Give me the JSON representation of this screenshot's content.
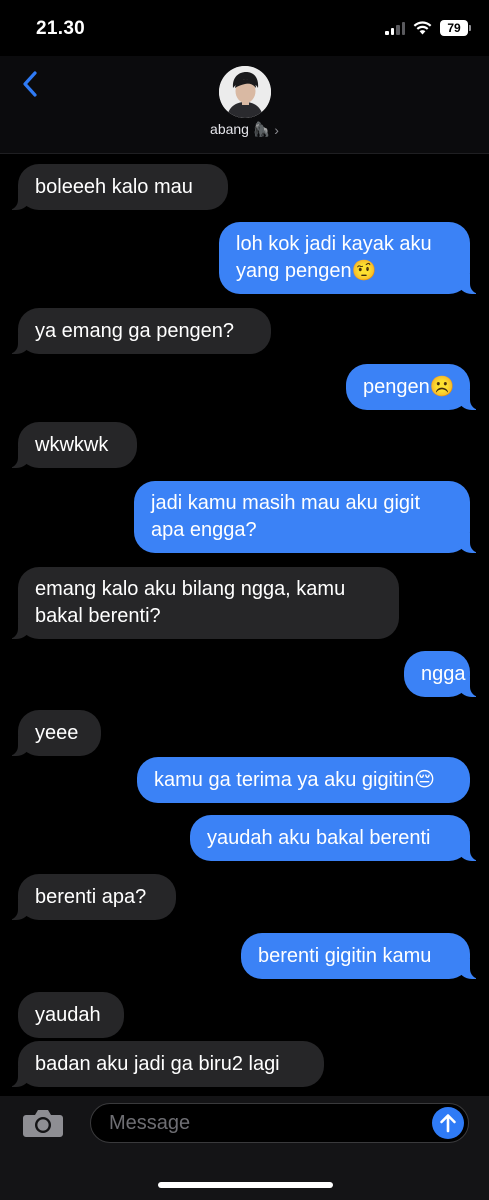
{
  "status_bar": {
    "time": "21.30",
    "battery": "79",
    "icons": [
      "cellular-signal-icon",
      "wifi-icon",
      "battery-icon"
    ]
  },
  "header": {
    "contact_name": "abang 🦍",
    "chevron": "›",
    "back_icon": "chevron-left-icon"
  },
  "messages": [
    {
      "dir": "in",
      "lines": [
        "boleeeh kalo mau"
      ]
    },
    {
      "dir": "out",
      "lines": [
        "loh kok jadi kayak aku",
        "yang pengen🤨"
      ]
    },
    {
      "dir": "in",
      "lines": [
        "ya emang ga pengen?"
      ]
    },
    {
      "dir": "out",
      "lines": [
        "pengen☹️"
      ]
    },
    {
      "dir": "in",
      "lines": [
        "wkwkwk"
      ]
    },
    {
      "dir": "out",
      "lines": [
        "jadi kamu masih mau aku gigit",
        "apa engga?"
      ]
    },
    {
      "dir": "in",
      "lines": [
        "emang kalo aku bilang ngga, kamu",
        "bakal berenti?"
      ]
    },
    {
      "dir": "out",
      "lines": [
        "ngga"
      ]
    },
    {
      "dir": "in",
      "lines": [
        "yeee"
      ]
    },
    {
      "dir": "out",
      "lines": [
        "kamu ga terima ya aku gigitin😔"
      ]
    },
    {
      "dir": "out",
      "lines": [
        "yaudah aku bakal berenti"
      ]
    },
    {
      "dir": "in",
      "lines": [
        "berenti apa?"
      ]
    },
    {
      "dir": "out",
      "lines": [
        "berenti gigitin kamu"
      ]
    },
    {
      "dir": "in",
      "lines": [
        "yaudah"
      ]
    },
    {
      "dir": "in",
      "lines": [
        "badan aku jadi ga biru2 lagi"
      ]
    }
  ],
  "input_bar": {
    "placeholder": "Message",
    "camera_icon": "camera-icon",
    "send_icon": "arrow-up-icon"
  },
  "colors": {
    "incoming_bubble": "#262628",
    "outgoing_bubble": "#3b82f6",
    "accent": "#2f7bf6",
    "background": "#000000"
  }
}
